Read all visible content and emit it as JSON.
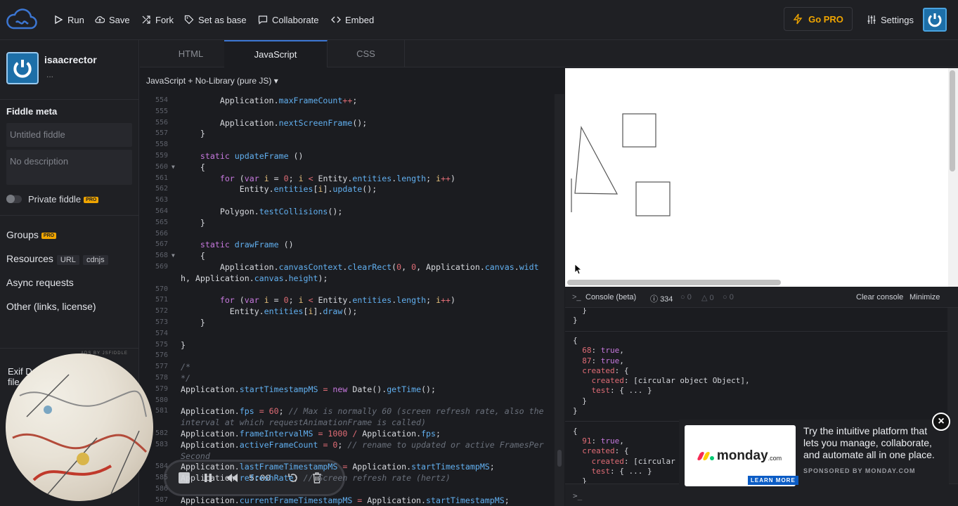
{
  "toolbar": {
    "run": "Run",
    "save": "Save",
    "fork": "Fork",
    "set_as_base": "Set as base",
    "collaborate": "Collaborate",
    "embed": "Embed",
    "go_pro": "Go PRO",
    "settings": "Settings"
  },
  "sidebar": {
    "username": "isaacrector",
    "user_sub": "...",
    "fiddle_meta_heading": "Fiddle meta",
    "title_placeholder": "Untitled fiddle",
    "description_placeholder": "No description",
    "private_label": "Private fiddle",
    "pro_badge": "PRO",
    "groups": "Groups",
    "resources": "Resources",
    "resources_tags": [
      "URL",
      "cdnjs"
    ],
    "async": "Async requests",
    "other": "Other (links, license)",
    "exif_text": "Exif D",
    "exif_text2": "file",
    "jsfiddle_mark": "ADS BY JSFIDDLE"
  },
  "player": {
    "timer": "5:00"
  },
  "tabs": [
    "HTML",
    "JavaScript",
    "CSS"
  ],
  "library_select": "JavaScript + No-Library (pure JS)",
  "editor_lines": [
    {
      "n": "554",
      "html": "        Application.<span class=\"f\">maxFrameCount</span><span class=\"n\">++</span>;"
    },
    {
      "n": "555",
      "html": ""
    },
    {
      "n": "556",
      "html": "        Application.<span class=\"f\">nextScreenFrame</span>();"
    },
    {
      "n": "557",
      "html": "    }"
    },
    {
      "n": "558",
      "html": ""
    },
    {
      "n": "559",
      "html": "    <span class=\"k\">static</span> <span class=\"f\">updateFrame</span> ()"
    },
    {
      "n": "560",
      "html": "    {",
      "fold": true
    },
    {
      "n": "561",
      "html": "        <span class=\"k\">for</span> (<span class=\"k\">var</span> <span class=\"s\">i</span> = <span class=\"n\">0</span>; <span class=\"s\">i</span> <span class=\"n\">&lt;</span> Entity.<span class=\"f\">entities</span>.<span class=\"f\">length</span>; <span class=\"s\">i</span><span class=\"n\">++</span>)"
    },
    {
      "n": "562",
      "html": "            Entity.<span class=\"f\">entities</span>[<span class=\"s\">i</span>].<span class=\"f\">update</span>();"
    },
    {
      "n": "563",
      "html": ""
    },
    {
      "n": "564",
      "html": "        Polygon.<span class=\"f\">testCollisions</span>();"
    },
    {
      "n": "565",
      "html": "    }"
    },
    {
      "n": "566",
      "html": ""
    },
    {
      "n": "567",
      "html": "    <span class=\"k\">static</span> <span class=\"f\">drawFrame</span> ()"
    },
    {
      "n": "568",
      "html": "    {",
      "fold": true
    },
    {
      "n": "569",
      "html": "        Application.<span class=\"f\">canvasContext</span>.<span class=\"f\">clearRect</span>(<span class=\"n\">0</span>, <span class=\"n\">0</span>, Application.<span class=\"f\">canvas</span>.<span class=\"f\">widt</span>"
    },
    {
      "n": "",
      "html": "h, Application.<span class=\"f\">canvas</span>.<span class=\"f\">height</span>);"
    },
    {
      "n": "570",
      "html": ""
    },
    {
      "n": "571",
      "html": "        <span class=\"k\">for</span> (<span class=\"k\">var</span> <span class=\"s\">i</span> = <span class=\"n\">0</span>; <span class=\"s\">i</span> <span class=\"n\">&lt;</span> Entity.<span class=\"f\">entities</span>.<span class=\"f\">length</span>; <span class=\"s\">i</span><span class=\"n\">++</span>)"
    },
    {
      "n": "572",
      "html": "          Entity.<span class=\"f\">entities</span>[<span class=\"s\">i</span>].<span class=\"f\">draw</span>();"
    },
    {
      "n": "573",
      "html": "    }"
    },
    {
      "n": "574",
      "html": ""
    },
    {
      "n": "575",
      "html": "}"
    },
    {
      "n": "576",
      "html": ""
    },
    {
      "n": "577",
      "html": "<span class=\"c\">/*</span>"
    },
    {
      "n": "578",
      "html": "<span class=\"c\">*/</span>"
    },
    {
      "n": "579",
      "html": "Application.<span class=\"f\">startTimestampMS</span> <span class=\"n\">=</span> <span class=\"k\">new</span> Date().<span class=\"f\">getTime</span>();"
    },
    {
      "n": "580",
      "html": ""
    },
    {
      "n": "581",
      "html": "Application.<span class=\"f\">fps</span> <span class=\"n\">=</span> <span class=\"n\">60</span>; <span class=\"c\">// Max is normally 60 (screen refresh rate, also the</span>"
    },
    {
      "n": "",
      "html": "<span class=\"c\">interval at which requestAnimationFrame is called)</span>"
    },
    {
      "n": "582",
      "html": "Application.<span class=\"f\">frameIntervalMS</span> <span class=\"n\">=</span> <span class=\"n\">1000</span> <span class=\"n\">/</span> Application.<span class=\"f\">fps</span>;"
    },
    {
      "n": "583",
      "html": "Application.<span class=\"f\">activeFrameCount</span> <span class=\"n\">=</span> <span class=\"n\">0</span>; <span class=\"c\">// rename to updated or active FramesPer</span>"
    },
    {
      "n": "",
      "html": "<span class=\"c\">Second</span>"
    },
    {
      "n": "584",
      "html": "Application.<span class=\"f\">lastFrameTimestampMS</span> <span class=\"n\">=</span> Application.<span class=\"f\">startTimestampMS</span>;"
    },
    {
      "n": "585",
      "html": "Application.<span class=\"f\">refreshRate</span>; <span class=\"c\">// Screen refresh rate (hertz)</span>"
    },
    {
      "n": "586",
      "html": ""
    },
    {
      "n": "587",
      "html": "Application.<span class=\"f\">currentFrameTimestampMS</span> <span class=\"n\">=</span> Application.<span class=\"f\">startTimestampMS</span>;"
    }
  ],
  "console": {
    "title": "Console (beta)",
    "count_info": "334",
    "count_warn": "0",
    "count_error": "0",
    "count_log": "0",
    "clear": "Clear console",
    "minimize": "Minimize",
    "prompt": ">_",
    "lines": [
      "  }",
      "}",
      "",
      "{",
      "  68: true,",
      "  87: true,",
      "  created: {",
      "    created: [circular object Object],",
      "    test: { ... }",
      "  }",
      "}",
      "",
      "{",
      "  91: true,",
      "  created: {",
      "    created: [circular o",
      "    test: { ... }",
      "  }"
    ]
  },
  "ad": {
    "brand": "monday",
    "brand_suffix": ".com",
    "learn_more": "LEARN MORE",
    "text": "Try the intuitive platform that lets you manage, collaborate, and automate all in one place.",
    "sponsor": "SPONSORED BY MONDAY.COM"
  },
  "colors": {
    "accent": "#3c76d2",
    "pro": "#f0a500",
    "avatar": "#1d6fa8"
  }
}
